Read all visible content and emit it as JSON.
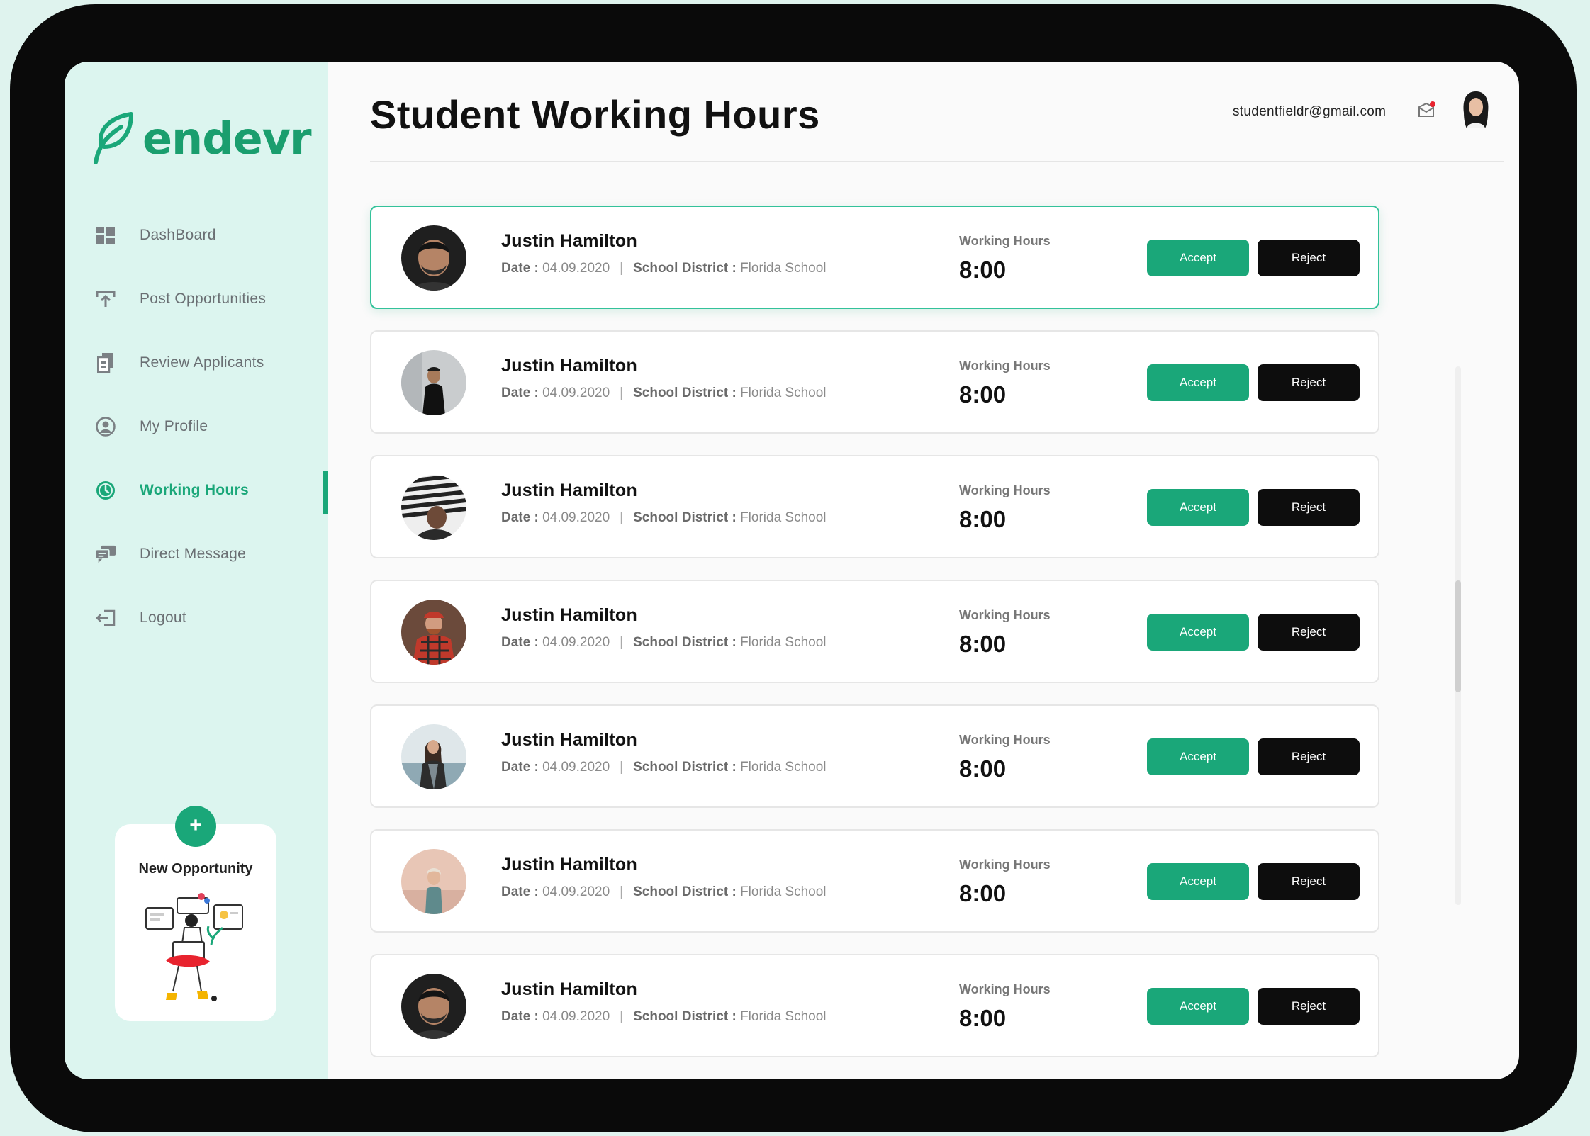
{
  "app": {
    "logo_text": "endevr",
    "page_title": "Student Working Hours",
    "user_email": "studentfieldr@gmail.com",
    "accent_color": "#1aa779"
  },
  "sidebar": {
    "items": [
      {
        "label": "DashBoard",
        "icon": "dashboard-icon"
      },
      {
        "label": "Post Opportunities",
        "icon": "upload-icon"
      },
      {
        "label": "Review Applicants",
        "icon": "documents-icon"
      },
      {
        "label": "My Profile",
        "icon": "user-icon"
      },
      {
        "label": "Working Hours",
        "icon": "clock-icon",
        "active": true
      },
      {
        "label": "Direct Message",
        "icon": "chat-icon"
      },
      {
        "label": "Logout",
        "icon": "logout-icon"
      }
    ],
    "new_opportunity": {
      "plus": "+",
      "label": "New Opportunity"
    }
  },
  "entries": [
    {
      "name": "Justin Hamilton",
      "date_label": "Date :",
      "date": "04.09.2020",
      "district_label": "School District :",
      "district": "Florida School",
      "hours_label": "Working Hours",
      "hours": "8:00",
      "accept": "Accept",
      "reject": "Reject",
      "selected": true
    },
    {
      "name": "Justin Hamilton",
      "date_label": "Date :",
      "date": "04.09.2020",
      "district_label": "School District :",
      "district": "Florida School",
      "hours_label": "Working Hours",
      "hours": "8:00",
      "accept": "Accept",
      "reject": "Reject"
    },
    {
      "name": "Justin Hamilton",
      "date_label": "Date :",
      "date": "04.09.2020",
      "district_label": "School District :",
      "district": "Florida School",
      "hours_label": "Working Hours",
      "hours": "8:00",
      "accept": "Accept",
      "reject": "Reject"
    },
    {
      "name": "Justin Hamilton",
      "date_label": "Date :",
      "date": "04.09.2020",
      "district_label": "School District :",
      "district": "Florida School",
      "hours_label": "Working Hours",
      "hours": "8:00",
      "accept": "Accept",
      "reject": "Reject"
    },
    {
      "name": "Justin Hamilton",
      "date_label": "Date :",
      "date": "04.09.2020",
      "district_label": "School District :",
      "district": "Florida School",
      "hours_label": "Working Hours",
      "hours": "8:00",
      "accept": "Accept",
      "reject": "Reject"
    },
    {
      "name": "Justin Hamilton",
      "date_label": "Date :",
      "date": "04.09.2020",
      "district_label": "School District :",
      "district": "Florida School",
      "hours_label": "Working Hours",
      "hours": "8:00",
      "accept": "Accept",
      "reject": "Reject"
    },
    {
      "name": "Justin Hamilton",
      "date_label": "Date :",
      "date": "04.09.2020",
      "district_label": "School District :",
      "district": "Florida School",
      "hours_label": "Working Hours",
      "hours": "8:00",
      "accept": "Accept",
      "reject": "Reject"
    }
  ]
}
